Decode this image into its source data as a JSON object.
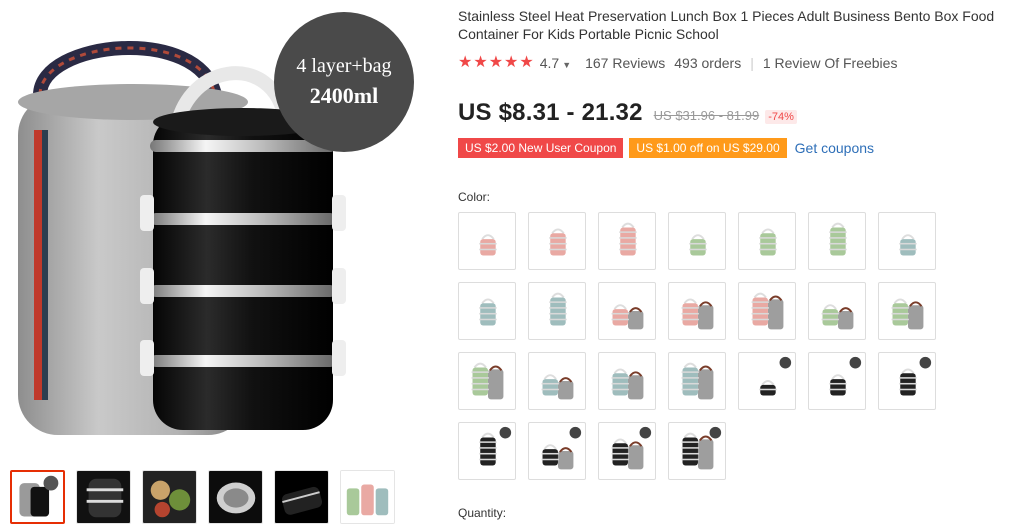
{
  "gallery": {
    "badge_line1": "4 layer+bag",
    "badge_line2": "2400ml",
    "thumbnails": [
      {
        "name": "thumb-black-bag",
        "kind": "black_bag",
        "active": true
      },
      {
        "name": "thumb-black-closeup",
        "kind": "black_close",
        "active": false
      },
      {
        "name": "thumb-food",
        "kind": "food",
        "active": false
      },
      {
        "name": "thumb-inside",
        "kind": "inside",
        "active": false
      },
      {
        "name": "thumb-black-layers",
        "kind": "black_layers",
        "active": false
      },
      {
        "name": "thumb-colors",
        "kind": "colors",
        "active": false
      }
    ]
  },
  "product": {
    "title": "Stainless Steel Heat Preservation Lunch Box 1 Pieces Adult Business Bento Box Food Container For Kids Portable Picnic School",
    "rating": "4.7",
    "reviews": "167 Reviews",
    "orders": "493 orders",
    "freebies": "1 Review Of Freebies",
    "price": "US $8.31 - 21.32",
    "original_price": "US $31.96 - 81.99",
    "discount": "-74%"
  },
  "coupons": {
    "new_user": "US $2.00 New User Coupon",
    "store": "US $1.00 off on US $29.00",
    "get": "Get coupons"
  },
  "colors": {
    "label": "Color:",
    "swatches": [
      {
        "color": "#e9a9a3",
        "layers": 2,
        "bag": false
      },
      {
        "color": "#e9a9a3",
        "layers": 3,
        "bag": false
      },
      {
        "color": "#e9a9a3",
        "layers": 4,
        "bag": false
      },
      {
        "color": "#a9c99a",
        "layers": 2,
        "bag": false
      },
      {
        "color": "#a9c99a",
        "layers": 3,
        "bag": false
      },
      {
        "color": "#a9c99a",
        "layers": 4,
        "bag": false
      },
      {
        "color": "#9fbdbd",
        "layers": 2,
        "bag": false
      },
      {
        "color": "#9fbdbd",
        "layers": 3,
        "bag": false
      },
      {
        "color": "#9fbdbd",
        "layers": 4,
        "bag": false
      },
      {
        "color": "#e9a9a3",
        "layers": 2,
        "bag": true
      },
      {
        "color": "#e9a9a3",
        "layers": 3,
        "bag": true
      },
      {
        "color": "#e9a9a3",
        "layers": 4,
        "bag": true
      },
      {
        "color": "#a9c99a",
        "layers": 2,
        "bag": true
      },
      {
        "color": "#a9c99a",
        "layers": 3,
        "bag": true
      },
      {
        "color": "#a9c99a",
        "layers": 4,
        "bag": true
      },
      {
        "color": "#9fbdbd",
        "layers": 2,
        "bag": true
      },
      {
        "color": "#9fbdbd",
        "layers": 3,
        "bag": true
      },
      {
        "color": "#9fbdbd",
        "layers": 4,
        "bag": true
      },
      {
        "color": "#222222",
        "layers": 1,
        "bag": false
      },
      {
        "color": "#222222",
        "layers": 2,
        "bag": false
      },
      {
        "color": "#222222",
        "layers": 3,
        "bag": false
      },
      {
        "color": "#222222",
        "layers": 4,
        "bag": false
      },
      {
        "color": "#222222",
        "layers": 2,
        "bag": true
      },
      {
        "color": "#222222",
        "layers": 3,
        "bag": true
      },
      {
        "color": "#222222",
        "layers": 4,
        "bag": true
      }
    ]
  },
  "quantity": {
    "label": "Quantity:"
  },
  "theme": {
    "accent": "#f04848",
    "coupon_orange": "#ff9a1a",
    "link": "#2e6fb8",
    "active_border": "#e62e04"
  }
}
